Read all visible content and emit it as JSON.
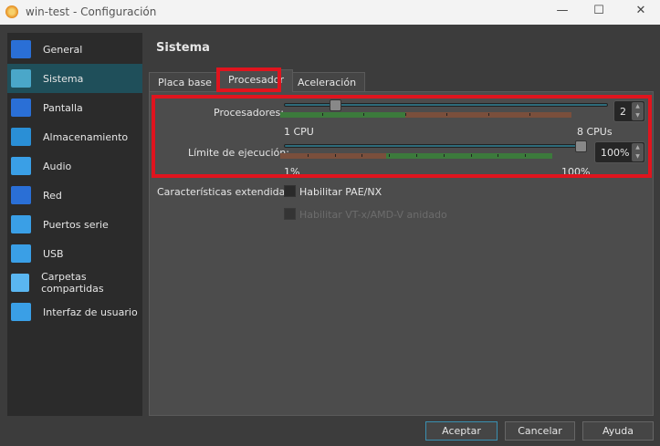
{
  "window": {
    "title": "win-test - Configuración",
    "minimize": "—",
    "maximize": "☐",
    "close": "✕"
  },
  "sidebar": {
    "items": [
      {
        "label": "General",
        "icon": "general-icon",
        "color": "#2a6fd6"
      },
      {
        "label": "Sistema",
        "icon": "system-icon",
        "color": "#4aa7c9",
        "selected": true
      },
      {
        "label": "Pantalla",
        "icon": "display-icon",
        "color": "#2a6fd6"
      },
      {
        "label": "Almacenamiento",
        "icon": "storage-icon",
        "color": "#2a8fd6"
      },
      {
        "label": "Audio",
        "icon": "audio-icon",
        "color": "#3a9fe6"
      },
      {
        "label": "Red",
        "icon": "network-icon",
        "color": "#2a6fd6"
      },
      {
        "label": "Puertos serie",
        "icon": "serial-ports-icon",
        "color": "#3a9fe6"
      },
      {
        "label": "USB",
        "icon": "usb-icon",
        "color": "#3a9fe6"
      },
      {
        "label": "Carpetas compartidas",
        "icon": "shared-folders-icon",
        "color": "#5ab6f0"
      },
      {
        "label": "Interfaz de usuario",
        "icon": "user-interface-icon",
        "color": "#3a9fe6"
      }
    ]
  },
  "header": {
    "title": "Sistema"
  },
  "tabs": [
    {
      "label": "Placa base"
    },
    {
      "label": "Procesador",
      "active": true
    },
    {
      "label": "Aceleración"
    }
  ],
  "processors": {
    "label": "Procesadores:",
    "value": "2",
    "min": 1,
    "max": 8,
    "min_label": "1 CPU",
    "max_label": "8 CPUs",
    "recommended_fraction": 0.43
  },
  "exec_cap": {
    "label": "Límite de ejecución:",
    "value": "100%",
    "percent": 100,
    "min_label": "1%",
    "max_label": "100%",
    "warning_fraction": 0.39
  },
  "extended": {
    "label": "Características extendidas:",
    "pae": "Habilitar PAE/NX",
    "vtx": "Habilitar VT-x/AMD-V anidado"
  },
  "buttons": {
    "ok": "Aceptar",
    "cancel": "Cancelar",
    "help": "Ayuda"
  },
  "colors": {
    "highlight": "#e0141e",
    "green": "#3c7a3c",
    "brown": "#7a4f3c"
  }
}
